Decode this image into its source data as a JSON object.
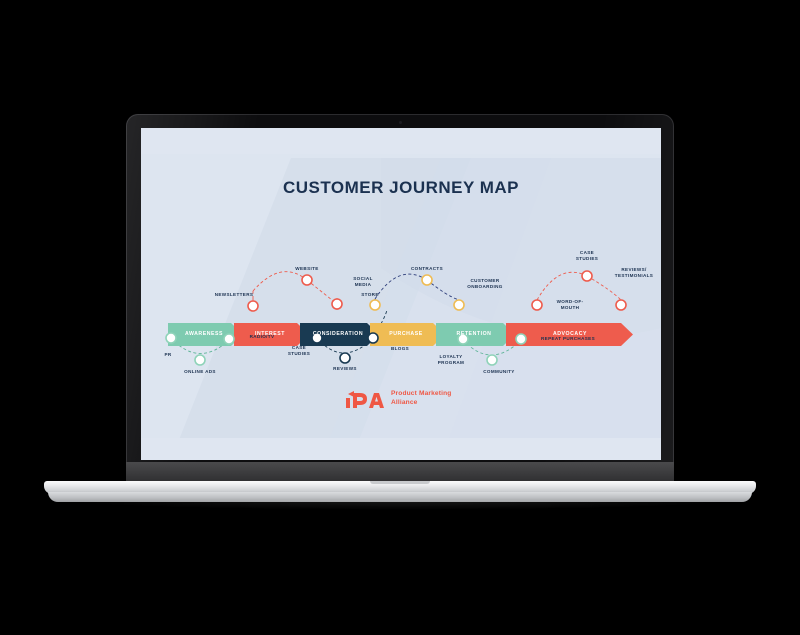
{
  "device": {
    "type": "laptop",
    "screen_bg": "#dde5f0"
  },
  "slide": {
    "title": "CUSTOMER JOURNEY MAP",
    "title_color": "#1b3150",
    "background": "#dde5f0"
  },
  "stages": [
    {
      "label": "AWARENESS",
      "color": "#7ecbb0"
    },
    {
      "label": "INTEREST",
      "color": "#ee5c4d"
    },
    {
      "label": "CONSIDERATION",
      "color": "#193a52"
    },
    {
      "label": "PURCHASE",
      "color": "#efbc54"
    },
    {
      "label": "RETENTION",
      "color": "#7ecbb0"
    },
    {
      "label": "ADVOCACY",
      "color": "#ee5c4d"
    }
  ],
  "touchpoints_top": [
    {
      "label": "NEWSLETTERS",
      "color": "#ee5c4d",
      "stage": "AWARENESS"
    },
    {
      "label": "WEBSITE",
      "color": "#ee5c4d",
      "stage": "INTEREST"
    },
    {
      "label": "SOCIAL\nMEDIA",
      "color": "#ee5c4d",
      "stage": "INTEREST"
    },
    {
      "label": "STORE",
      "color": "#efbc54",
      "stage": "CONSIDERATION"
    },
    {
      "label": "CONTRACTS",
      "color": "#efbc54",
      "stage": "PURCHASE"
    },
    {
      "label": "CUSTOMER\nONBOARDING",
      "color": "#efbc54",
      "stage": "PURCHASE"
    },
    {
      "label": "WORD-OF-\nMOUTH",
      "color": "#ee5c4d",
      "stage": "RETENTION"
    },
    {
      "label": "CASE\nSTUDIES",
      "color": "#ee5c4d",
      "stage": "ADVOCACY"
    },
    {
      "label": "REVIEWS/\nTESTIMONIALS",
      "color": "#ee5c4d",
      "stage": "ADVOCACY"
    }
  ],
  "touchpoints_bottom": [
    {
      "label": "PR",
      "color": "#7ecbb0",
      "stage": "AWARENESS"
    },
    {
      "label": "ONLINE ADS",
      "color": "#7ecbb0",
      "stage": "AWARENESS"
    },
    {
      "label": "RADIO/TV",
      "color": "#7ecbb0",
      "stage": "AWARENESS"
    },
    {
      "label": "CASE\nSTUDIES",
      "color": "#193a52",
      "stage": "INTEREST"
    },
    {
      "label": "REVIEWS",
      "color": "#193a52",
      "stage": "CONSIDERATION"
    },
    {
      "label": "BLOGS",
      "color": "#193a52",
      "stage": "CONSIDERATION"
    },
    {
      "label": "LOYALTY\nPROGRAM",
      "color": "#7ecbb0",
      "stage": "PURCHASE"
    },
    {
      "label": "COMMUNITY",
      "color": "#7ecbb0",
      "stage": "RETENTION"
    },
    {
      "label": "REPEAT PURCHASES",
      "color": "#7ecbb0",
      "stage": "RETENTION"
    }
  ],
  "logo": {
    "mark": "PMA",
    "line1": "Product Marketing",
    "line2": "Alliance",
    "color": "#ef5744"
  },
  "chart_data": {
    "type": "diagram",
    "title": "CUSTOMER JOURNEY MAP",
    "stage_sequence": [
      "AWARENESS",
      "INTEREST",
      "CONSIDERATION",
      "PURCHASE",
      "RETENTION",
      "ADVOCACY"
    ],
    "above_axis_touchpoints": [
      "NEWSLETTERS",
      "WEBSITE",
      "SOCIAL MEDIA",
      "STORE",
      "CONTRACTS",
      "CUSTOMER ONBOARDING",
      "WORD-OF-MOUTH",
      "CASE STUDIES",
      "REVIEWS/TESTIMONIALS"
    ],
    "below_axis_touchpoints": [
      "PR",
      "ONLINE ADS",
      "RADIO/TV",
      "CASE STUDIES",
      "REVIEWS",
      "BLOGS",
      "LOYALTY PROGRAM",
      "COMMUNITY",
      "REPEAT PURCHASES"
    ],
    "palette": {
      "mint": "#7ecbb0",
      "coral": "#ee5c4d",
      "navy": "#193a52",
      "gold": "#efbc54"
    }
  }
}
